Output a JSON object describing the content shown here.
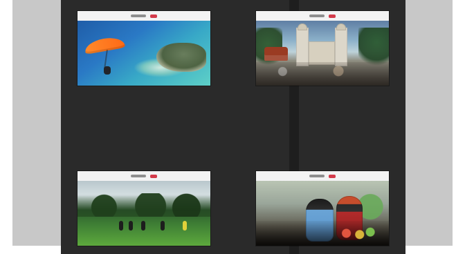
{
  "ui": {
    "thumbnails": [
      {
        "icon": "coastline-parachute-image"
      },
      {
        "icon": "plaza-church-image"
      },
      {
        "icon": "forest-hikers-image"
      },
      {
        "icon": "market-vendors-image"
      }
    ]
  },
  "colors": {
    "canvas": "#c8c8c8",
    "viewer": "#2a2a2a",
    "divider": "#1e1e1e"
  }
}
